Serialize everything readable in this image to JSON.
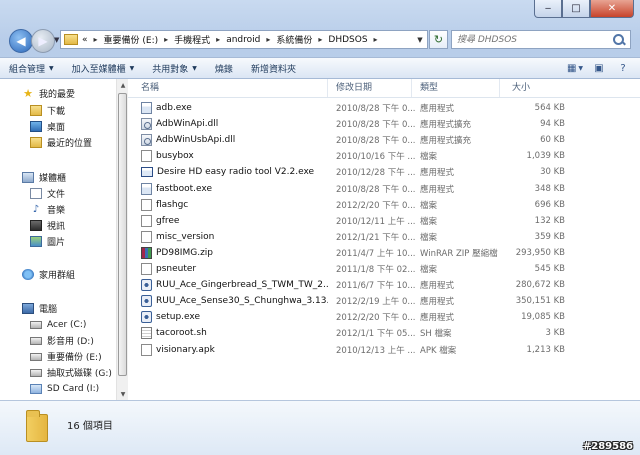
{
  "window": {
    "minimize": "‒",
    "maximize": "□",
    "close": "✕"
  },
  "address": {
    "breadcrumbs": [
      "«",
      "重要備份 (E:)",
      "手機程式",
      "android",
      "系統備份",
      "DHDSOS"
    ]
  },
  "search": {
    "placeholder": "搜尋 DHDSOS"
  },
  "toolbar": {
    "organize": "組合管理",
    "include_library": "加入至媒體櫃",
    "share": "共用對象",
    "burn": "燒錄",
    "new_folder": "新增資料夾"
  },
  "nav": {
    "favorites": "我的最愛",
    "downloads": "下載",
    "desktop": "桌面",
    "recent": "最近的位置",
    "libraries": "媒體櫃",
    "documents": "文件",
    "music": "音樂",
    "videos": "視訊",
    "pictures": "圖片",
    "homegroup": "家用群組",
    "computer": "電腦",
    "drive_c": "Acer (C:)",
    "drive_d": "影音用 (D:)",
    "drive_e": "重要備份 (E:)",
    "drive_g": "抽取式磁碟 (G:)",
    "drive_i": "SD Card (I:)"
  },
  "columns": {
    "name": "名稱",
    "date": "修改日期",
    "type": "類型",
    "size": "大小"
  },
  "files": [
    {
      "name": "adb.exe",
      "date": "2010/8/28 下午 0...",
      "type": "應用程式",
      "size": "564 KB",
      "icon": "exe-icon"
    },
    {
      "name": "AdbWinApi.dll",
      "date": "2010/8/28 下午 0...",
      "type": "應用程式擴充",
      "size": "94 KB",
      "icon": "dll-icon"
    },
    {
      "name": "AdbWinUsbApi.dll",
      "date": "2010/8/28 下午 0...",
      "type": "應用程式擴充",
      "size": "60 KB",
      "icon": "dll-icon"
    },
    {
      "name": "busybox",
      "date": "2010/10/16 下午 ...",
      "type": "檔案",
      "size": "1,039 KB",
      "icon": "file-icon"
    },
    {
      "name": "Desire HD easy radio tool V2.2.exe",
      "date": "2010/12/28 下午 ...",
      "type": "應用程式",
      "size": "30 KB",
      "icon": "window-icon"
    },
    {
      "name": "fastboot.exe",
      "date": "2010/8/28 下午 0...",
      "type": "應用程式",
      "size": "348 KB",
      "icon": "exe-icon"
    },
    {
      "name": "flashgc",
      "date": "2012/2/20 下午 0...",
      "type": "檔案",
      "size": "696 KB",
      "icon": "file-icon"
    },
    {
      "name": "gfree",
      "date": "2010/12/11 上午 ...",
      "type": "檔案",
      "size": "132 KB",
      "icon": "file-icon"
    },
    {
      "name": "misc_version",
      "date": "2012/1/21 下午 0...",
      "type": "檔案",
      "size": "359 KB",
      "icon": "file-icon"
    },
    {
      "name": "PD98IMG.zip",
      "date": "2011/4/7 上午 10...",
      "type": "WinRAR ZIP 壓縮檔",
      "size": "293,950 KB",
      "icon": "zip-icon"
    },
    {
      "name": "psneuter",
      "date": "2011/1/8 下午 02...",
      "type": "檔案",
      "size": "545 KB",
      "icon": "file-icon"
    },
    {
      "name": "RUU_Ace_Gingerbread_S_TWM_TW_2....",
      "date": "2011/6/7 下午 10...",
      "type": "應用程式",
      "size": "280,672 KB",
      "icon": "ruu-icon"
    },
    {
      "name": "RUU_Ace_Sense30_S_Chunghwa_3.13....",
      "date": "2012/2/19 上午 0...",
      "type": "應用程式",
      "size": "350,151 KB",
      "icon": "ruu-icon"
    },
    {
      "name": "setup.exe",
      "date": "2012/2/20 下午 0...",
      "type": "應用程式",
      "size": "19,085 KB",
      "icon": "ruu-icon"
    },
    {
      "name": "tacoroot.sh",
      "date": "2012/1/1 下午 05...",
      "type": "SH 檔案",
      "size": "3 KB",
      "icon": "script-icon"
    },
    {
      "name": "visionary.apk",
      "date": "2010/12/13 上午 ...",
      "type": "APK 檔案",
      "size": "1,213 KB",
      "icon": "file-icon"
    }
  ],
  "status": {
    "item_count": "16 個項目"
  },
  "watermark": "#289586"
}
